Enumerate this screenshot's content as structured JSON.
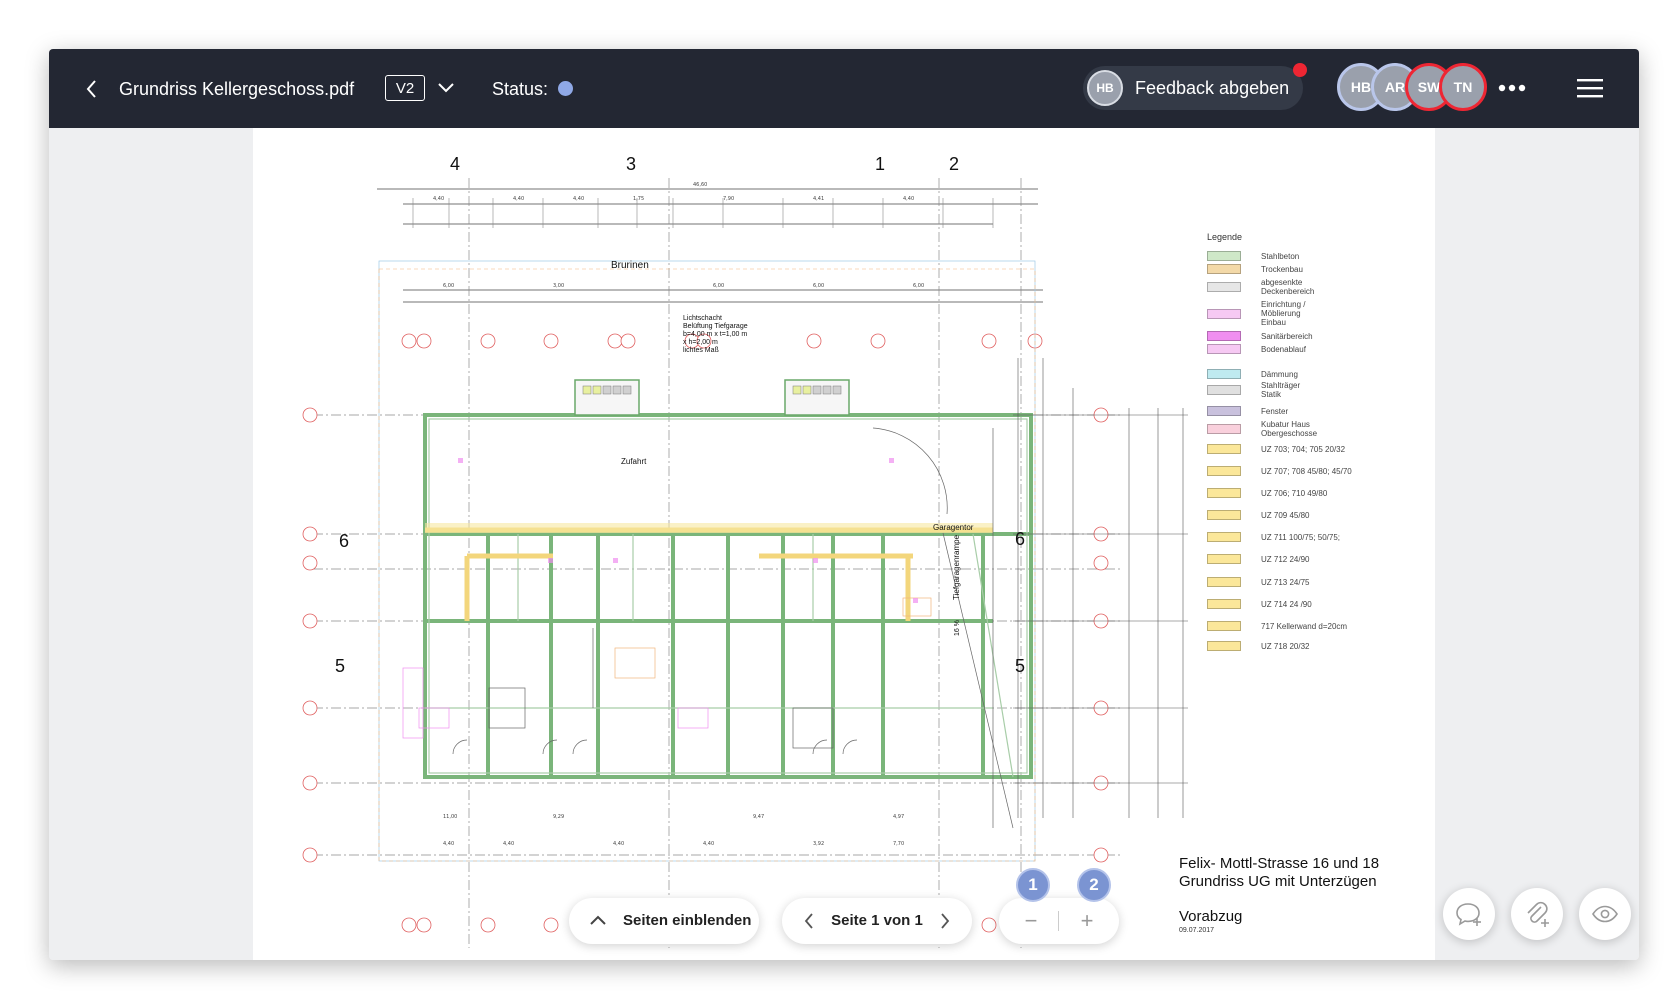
{
  "header": {
    "title": "Grundriss Kellergeschoss.pdf",
    "version": "V2",
    "status_label": "Status:",
    "status_color": "#8fa8e6",
    "feedback": {
      "avatar": "HB",
      "label": "Feedback abgeben"
    },
    "collaborators": [
      {
        "initials": "HB",
        "ring": "#b9c6ea"
      },
      {
        "initials": "AR",
        "ring": "#b9c6ea"
      },
      {
        "initials": "SW",
        "ring": "#ee2633"
      },
      {
        "initials": "TN",
        "ring": "#ee2633"
      }
    ]
  },
  "drawing": {
    "axis_top": [
      "4",
      "3",
      "1",
      "2"
    ],
    "room_labels": {
      "well": "Brurinen",
      "lightshaft": [
        "Lichtschacht",
        "Belüftung Tiefgarage",
        "b=4,00 m x t=1,00 m",
        "x h=2,00 m",
        "lichtes Maß"
      ],
      "driveway": "Zufahrt",
      "garage_door": "Garagentor",
      "ramp": "Tiefgaragenrampe",
      "slope": "16 %"
    },
    "section_marks": {
      "six": "6",
      "five": "5"
    },
    "legend": {
      "title": "Legende",
      "items": [
        {
          "label": "Stahlbeton",
          "color": "#cfe8c8"
        },
        {
          "label": "Trockenbau",
          "color": "#f3d9a8"
        },
        {
          "label": "abgesenkte\nDeckenbereich",
          "color": "#e6e6e6"
        },
        {
          "label": "Einrichtung /\nMöblierung\nEinbau",
          "color": "#f6c9f3"
        },
        {
          "label": "Sanitärbereich",
          "color": "#f08ef0"
        },
        {
          "label": "Bodenablauf",
          "color": "#f6c9f3"
        },
        {
          "label": "Dämmung",
          "color": "#bfeaf0"
        },
        {
          "label": "Stahlträger\nStatik",
          "color": "#e0e0e0"
        },
        {
          "label": "Fenster",
          "color": "#c9c1dd"
        },
        {
          "label": "Kubatur Haus\nObergeschosse",
          "color": "#f9d0dc"
        },
        {
          "label": "UZ 703; 704; 705   20/32",
          "color": "#fbe79a"
        },
        {
          "label": "UZ 707; 708    45/80; 45/70",
          "color": "#fbe79a"
        },
        {
          "label": "UZ 706; 710    49/80",
          "color": "#fbe79a"
        },
        {
          "label": "UZ 709    45/80",
          "color": "#fbe79a"
        },
        {
          "label": "UZ 711    100/75; 50/75;",
          "color": "#fbe79a"
        },
        {
          "label": "UZ 712    24/90",
          "color": "#fbe79a"
        },
        {
          "label": "UZ 713    24/75",
          "color": "#fbe79a"
        },
        {
          "label": "UZ 714    24 /90",
          "color": "#fbe79a"
        },
        {
          "label": "717  Kellerwand d=20cm",
          "color": "#fbe79a"
        },
        {
          "label": "UZ 718   20/32",
          "color": "#fbe79a"
        }
      ]
    },
    "project": {
      "line1": "Felix- Mottl-Strasse 16 und 18",
      "line2": "Grundriss UG mit Unterzügen",
      "draft": "Vorabzug",
      "date": "09.07.2017"
    }
  },
  "toolbar": {
    "pages_toggle": "Seiten einblenden",
    "pager": "Seite 1 von 1",
    "zoom_out": "−",
    "zoom_in": "+",
    "markers": [
      "1",
      "2"
    ]
  }
}
